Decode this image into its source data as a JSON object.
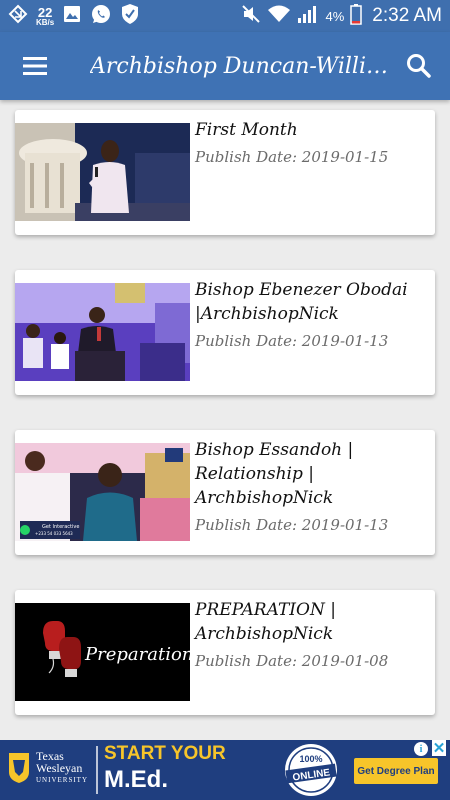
{
  "status_bar": {
    "net_speed": "22",
    "net_unit": "KB/s",
    "battery_pct": "4%",
    "time": "2:32 AM",
    "icons": [
      "notification-icon",
      "image-icon",
      "whatsapp-icon",
      "shield-icon",
      "mute-icon",
      "wifi-icon",
      "signal-icon",
      "battery-icon"
    ]
  },
  "app_bar": {
    "title": "Archbishop Duncan-Williams",
    "menu_icon": "hamburger-menu-icon",
    "search_icon": "search-icon",
    "color": "#3f72b4"
  },
  "videos": [
    {
      "title": "First Month",
      "date": "Publish Date: 2019-01-15"
    },
    {
      "title": "Bishop Ebenezer Obodai |ArchbishopNick",
      "date": "Publish Date: 2019-01-13"
    },
    {
      "title": "Bishop Essandoh | Relationship | ArchbishopNick",
      "date": "Publish Date: 2019-01-13"
    },
    {
      "title": "PREPARATION | ArchbishopNick",
      "date": "Publish Date: 2019-01-08"
    }
  ],
  "thumb_text": {
    "whatsapp_line1": "Get Interactive",
    "whatsapp_line2": "+233 54 033 5643",
    "preparation": "Preparation"
  },
  "ad": {
    "school_line1": "Texas",
    "school_line2": "Wesleyan",
    "school_line3": "UNIVERSITY",
    "headline1": "START YOUR",
    "headline2": "M.Ed.",
    "badge_top": "100%",
    "badge_main": "ONLINE",
    "cta": "Get Degree Plan",
    "info_label": "i",
    "close_label": "✕",
    "accent": "#f7c52a"
  }
}
